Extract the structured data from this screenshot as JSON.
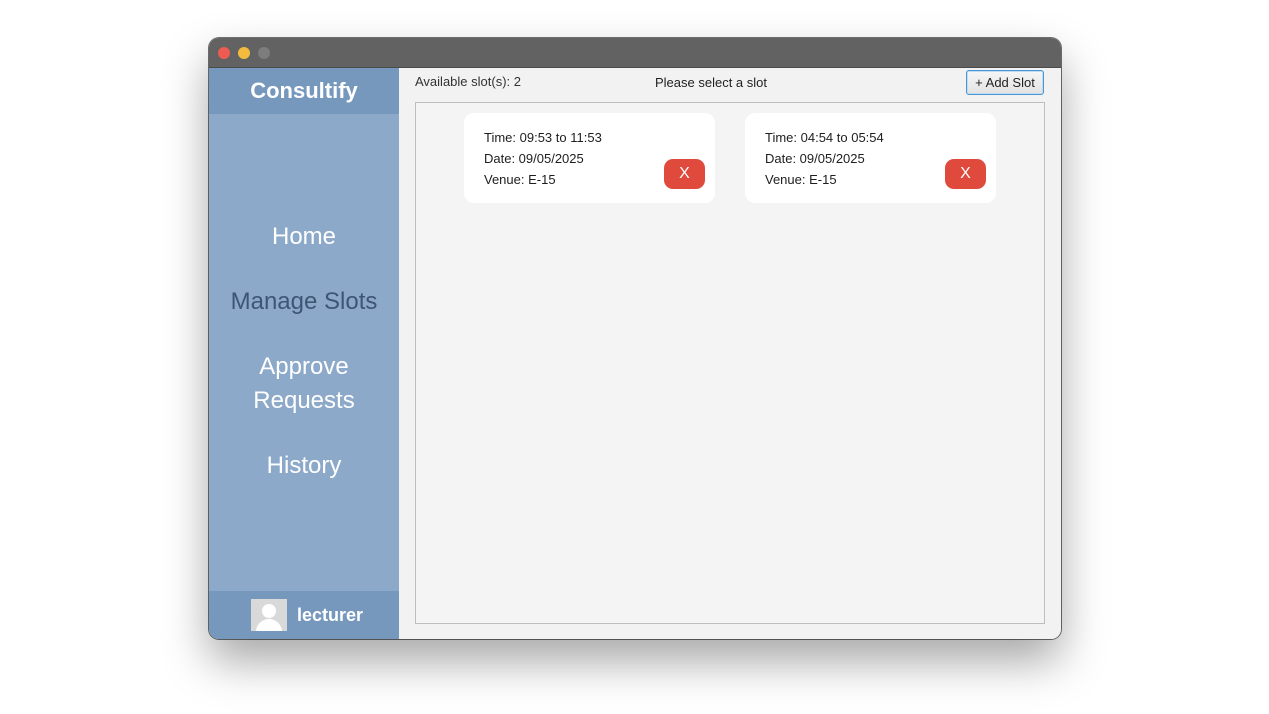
{
  "app": {
    "brand": "Consultify"
  },
  "sidebar": {
    "items": [
      {
        "label": "Home",
        "active": false
      },
      {
        "label": "Manage Slots",
        "active": true
      },
      {
        "label": "Approve",
        "label2": "Requests",
        "active": false
      },
      {
        "label": "History",
        "active": false
      }
    ],
    "user": {
      "name": "lecturer",
      "avatar_icon": "user-avatar-icon"
    }
  },
  "main": {
    "available_text": "Available slot(s): 2",
    "prompt_text": "Please select a slot",
    "add_button_label": "+ Add Slot",
    "slots": [
      {
        "time": "Time: 09:53 to 11:53",
        "date": "Date: 09/05/2025",
        "venue": "Venue: E-15",
        "delete_label": "X"
      },
      {
        "time": "Time: 04:54 to 05:54",
        "date": "Date: 09/05/2025",
        "venue": "Venue: E-15",
        "delete_label": "X"
      }
    ]
  },
  "colors": {
    "sidebar": "#8ca9c9",
    "sidebar_header": "#7698bd",
    "active_nav": "#3e5676",
    "delete_button": "#e04a3d"
  }
}
